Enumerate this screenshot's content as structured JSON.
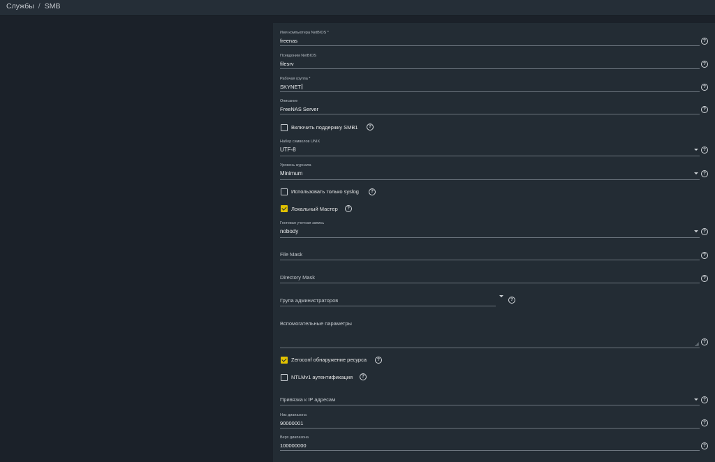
{
  "breadcrumb": {
    "parent": "Службы",
    "separator": "/",
    "current": "SMB"
  },
  "form": {
    "netbios_name": {
      "label": "Имя компьютера NetBIOS *",
      "value": "freenas"
    },
    "netbios_alias": {
      "label": "Псевдоним NetBIOS",
      "value": "filesrv"
    },
    "workgroup": {
      "label": "Рабочая группа *",
      "value": "SKYNET"
    },
    "description": {
      "label": "Описание",
      "value": "FreeNAS Server"
    },
    "enable_smb1": {
      "label": "Включить поддержку SMB1",
      "checked": false
    },
    "unix_charset": {
      "label": "Набор символов UNIX",
      "value": "UTF-8"
    },
    "log_level": {
      "label": "Уровень журнала",
      "value": "Minimum"
    },
    "syslog_only": {
      "label": "Использовать только syslog",
      "checked": false
    },
    "local_master": {
      "label": "Локальный Мастер",
      "checked": true
    },
    "guest_account": {
      "label": "Гостевая учетная запись",
      "value": "nobody"
    },
    "file_mask": {
      "placeholder": "File Mask"
    },
    "directory_mask": {
      "placeholder": "Directory Mask"
    },
    "admin_group": {
      "placeholder": "Група администраторов"
    },
    "aux_params": {
      "placeholder": "Вспомогательные параметры"
    },
    "zeroconf": {
      "label": "Zeroconf обнаружение ресурса",
      "checked": true
    },
    "ntlmv1": {
      "label": "NTLMv1 аутентификация",
      "checked": false
    },
    "bind_ip": {
      "placeholder": "Привязка к IP адресам"
    },
    "range_low": {
      "label": "Низ диапазона",
      "value": "90000001"
    },
    "range_high": {
      "label": "Верх диапазона",
      "value": "100000000"
    }
  },
  "icons": {
    "help": "?"
  },
  "colors": {
    "accent": "#e2c200",
    "card": "#232c34",
    "background": "#1b2129",
    "topbar": "#252e37"
  }
}
